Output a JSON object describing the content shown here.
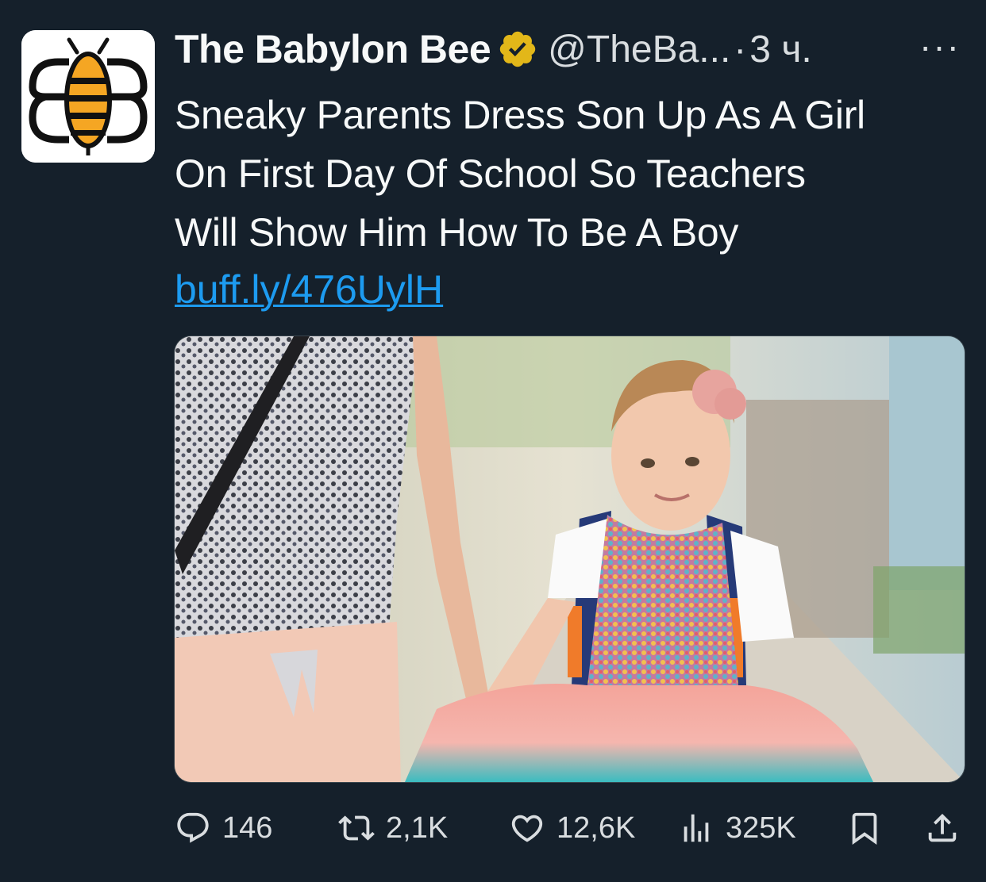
{
  "tweet": {
    "author_name": "The Babylon Bee",
    "handle": "@TheBa...",
    "separator": "·",
    "time": "3 ч.",
    "more_label": "···",
    "text_lines": [
      "Sneaky Parents Dress Son Up As A Girl",
      "On First Day Of School So Teachers",
      "Will Show Him How To Be A Boy"
    ],
    "link": "buff.ly/476UylH"
  },
  "icons": {
    "avatar": "babylon-bee-logo",
    "verified": "verified-gold-badge-icon",
    "reply": "reply-icon",
    "retweet": "retweet-icon",
    "like": "heart-icon",
    "views": "views-icon",
    "bookmark": "bookmark-icon",
    "share": "share-icon"
  },
  "actions": {
    "replies": "146",
    "retweets": "2,1K",
    "likes": "12,6K",
    "views": "325K"
  },
  "colors": {
    "background": "#15202b",
    "link": "#1d9bf0",
    "verified": "#e2b719",
    "muted": "#d9dde0"
  }
}
